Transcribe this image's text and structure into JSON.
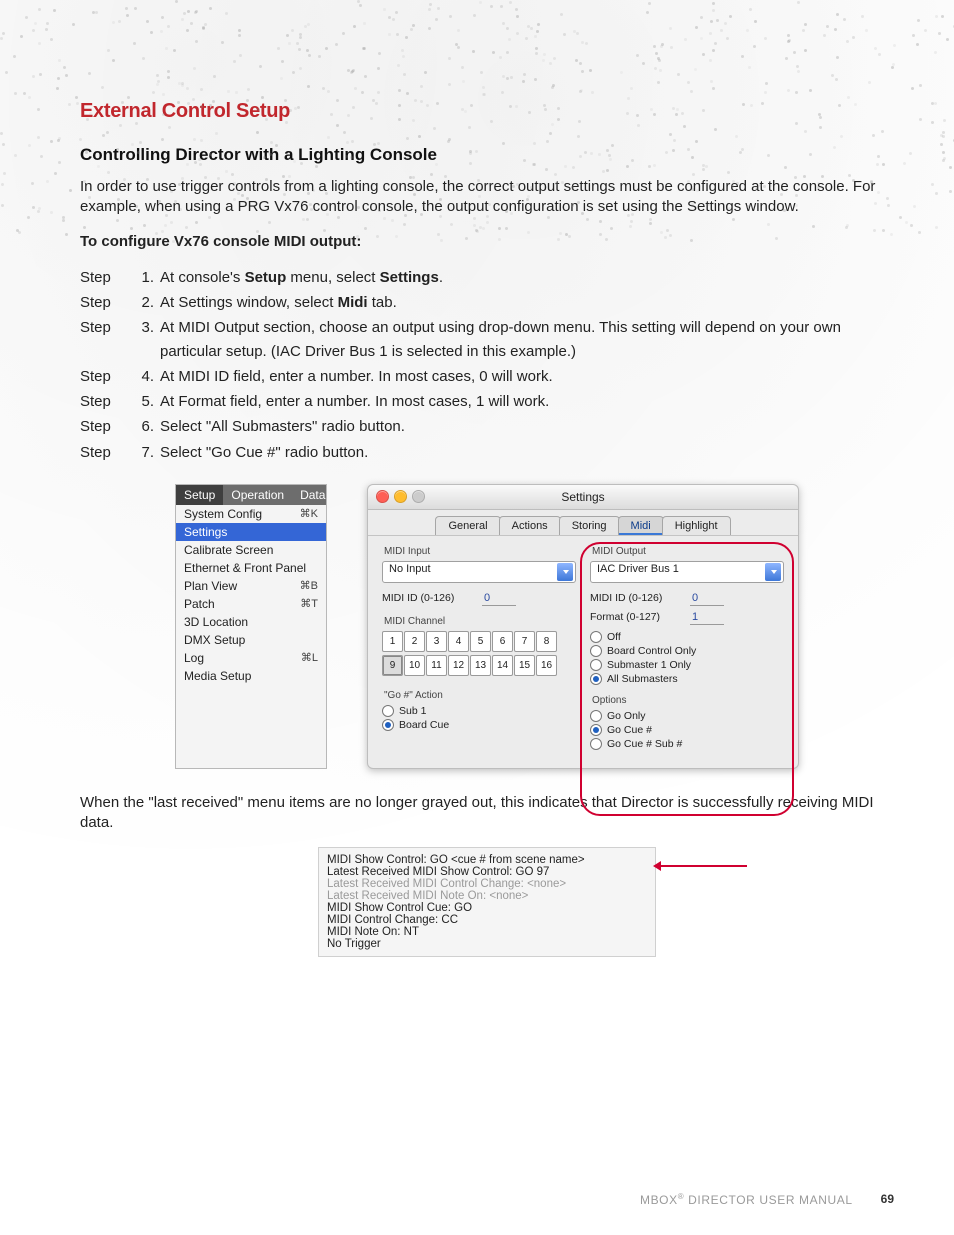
{
  "heading": "External Control Setup",
  "subheading": "Controlling Director with a Lighting Console",
  "intro_1": "In order to use trigger controls from a lighting console, the correct output settings must be configured at the console. For example, when using a PRG Vx76 control console, the output configuration is set using the Settings window.",
  "configure_label": "To configure Vx76 console MIDI output:",
  "step_label": "Step",
  "steps": [
    {
      "n": "1.",
      "plain_before": "At console's ",
      "bold1": "Setup",
      "mid": " menu, select ",
      "bold2": "Settings",
      "after": "."
    },
    {
      "n": "2.",
      "plain_before": "At Settings window, select ",
      "bold1": "Midi",
      "mid": " tab.",
      "bold2": "",
      "after": ""
    },
    {
      "n": "3.",
      "plain_before": "At MIDI Output section, choose an output using drop-down menu. This setting will depend on your own particular setup. (IAC Driver Bus 1 is selected in this example.)",
      "bold1": "",
      "mid": "",
      "bold2": "",
      "after": ""
    },
    {
      "n": "4.",
      "plain_before": "At MIDI ID field, enter a number. In most cases, 0 will work.",
      "bold1": "",
      "mid": "",
      "bold2": "",
      "after": ""
    },
    {
      "n": "5.",
      "plain_before": "At Format field, enter a number. In most cases, 1 will work.",
      "bold1": "",
      "mid": "",
      "bold2": "",
      "after": ""
    },
    {
      "n": "6.",
      "plain_before": "Select \"All Submasters\" radio button.",
      "bold1": "",
      "mid": "",
      "bold2": "",
      "after": ""
    },
    {
      "n": "7.",
      "plain_before": "Select \"Go Cue #\" radio button.",
      "bold1": "",
      "mid": "",
      "bold2": "",
      "after": ""
    }
  ],
  "menu": {
    "tabs": [
      "Setup",
      "Operation",
      "Data"
    ],
    "items": [
      {
        "label": "System Config",
        "sc": "⌘K"
      },
      {
        "label": "Settings",
        "sc": "",
        "selected": true
      },
      {
        "label": "Calibrate Screen",
        "sc": ""
      },
      {
        "label": "Ethernet & Front Panel",
        "sc": ""
      },
      {
        "label": "Plan View",
        "sc": "⌘B"
      },
      {
        "label": "Patch",
        "sc": "⌘T"
      },
      {
        "label": "3D Location",
        "sc": ""
      },
      {
        "label": "DMX Setup",
        "sc": ""
      },
      {
        "label": "Log",
        "sc": "⌘L"
      },
      {
        "label": "Media Setup",
        "sc": ""
      }
    ]
  },
  "settings": {
    "title": "Settings",
    "tabs": [
      "General",
      "Actions",
      "Storing",
      "Midi",
      "Highlight"
    ],
    "active_tab": "Midi",
    "left": {
      "section1": "MIDI Input",
      "input_dd": "No Input",
      "midi_id_lbl": "MIDI ID (0-126)",
      "midi_id_val": "0",
      "section2": "MIDI Channel",
      "selected_ch": "9",
      "section3": "\"Go #\" Action",
      "radios": [
        {
          "label": "Sub 1",
          "on": false
        },
        {
          "label": "Board Cue",
          "on": true
        }
      ]
    },
    "right": {
      "section1": "MIDI Output",
      "output_dd": "IAC Driver Bus 1",
      "midi_id_lbl": "MIDI ID (0-126)",
      "midi_id_val": "0",
      "format_lbl": "Format (0-127)",
      "format_val": "1",
      "mode_radios": [
        {
          "label": "Off",
          "on": false
        },
        {
          "label": "Board Control Only",
          "on": false
        },
        {
          "label": "Submaster 1 Only",
          "on": false
        },
        {
          "label": "All Submasters",
          "on": true
        }
      ],
      "section2": "Options",
      "opt_radios": [
        {
          "label": "Go Only",
          "on": false
        },
        {
          "label": "Go Cue #",
          "on": true
        },
        {
          "label": "Go Cue # Sub #",
          "on": false
        }
      ]
    }
  },
  "followup": "When the \"last received\" menu items are no longer grayed out, this indicates that Director is successfully receiving MIDI data.",
  "midi_list": [
    {
      "text": "MIDI Show Control: GO <cue # from scene name>",
      "grey": false
    },
    {
      "text": "Latest Received MIDI Show Control: GO 97",
      "grey": false,
      "arrow": true
    },
    {
      "text": "Latest Received MIDI Control Change: <none>",
      "grey": true
    },
    {
      "text": "Latest Received MIDI Note On: <none>",
      "grey": true
    },
    {
      "text": "MIDI Show Control Cue: GO",
      "grey": false
    },
    {
      "text": "MIDI Control Change: CC",
      "grey": false
    },
    {
      "text": "MIDI Note On: NT",
      "grey": false
    },
    {
      "text": "No Trigger",
      "grey": false
    }
  ],
  "footer": {
    "brand_pre": "MBOX",
    "brand_post": " DIRECTOR USER MANUAL",
    "page": "69"
  }
}
